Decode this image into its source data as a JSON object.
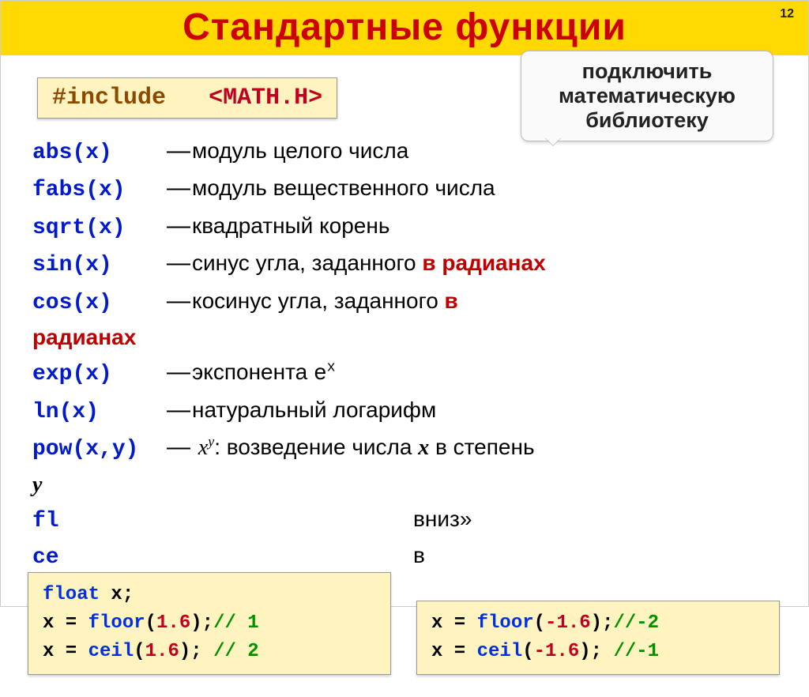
{
  "slide_number": "12",
  "title": "Стандартные функции",
  "callout": "подключить математическую библиотеку",
  "include": {
    "directive": "#include",
    "header": "<MATH.H>"
  },
  "funcs": [
    {
      "name": "abs(x)",
      "desc_before": "модуль целого числа",
      "desc_red": "",
      "desc_after": ""
    },
    {
      "name": "fabs(x)",
      "desc_before": "модуль вещественного числа",
      "desc_red": "",
      "desc_after": ""
    },
    {
      "name": "sqrt(x)",
      "desc_before": "квадратный корень",
      "desc_red": "",
      "desc_after": ""
    },
    {
      "name": "sin(x)",
      "desc_before": "синус угла, заданного ",
      "desc_red": "в радианах",
      "desc_after": ""
    },
    {
      "name": "cos(x)",
      "desc_before": "косинус угла, заданного ",
      "desc_red": "в",
      "desc_after": ""
    }
  ],
  "radians_wrap": "радианах",
  "funcs2": [
    {
      "name": "exp(x)",
      "desc_before": "экспонента ",
      "extra_mono": "e",
      "sup": "x",
      "desc_after": ""
    },
    {
      "name": "ln(x)",
      "desc_before": "натуральный логарифм",
      "extra_mono": "",
      "sup": "",
      "desc_after": ""
    },
    {
      "name": "pow(x,y)",
      "desc_before": "",
      "formula_base": "x",
      "formula_sup": "y",
      "desc_after": ": возведение числа ",
      "ital": "x",
      "desc_tail": " в степень"
    }
  ],
  "y_tail": "y",
  "behind": {
    "fl": "fl",
    "down_tail": "вниз»",
    "ce": "ce",
    "up_tail": "в"
  },
  "codebox_left": {
    "l1_a": "float ",
    "l1_b": "x;",
    "l2_a": "x",
    "l2_eq": " = ",
    "l2_fn": "floor",
    "l2_open": "(",
    "l2_num": "1.6",
    "l2_close": ");",
    "l2_cmt": "// 1",
    "l3_a": "x",
    "l3_eq": " = ",
    "l3_fn": "ceil",
    "l3_open": "(",
    "l3_num": "1.6",
    "l3_close": "); ",
    "l3_cmt": "// 2"
  },
  "codebox_right": {
    "l1_a": "x",
    "l1_eq": " = ",
    "l1_fn": "floor",
    "l1_open": "(",
    "l1_num": "-1.6",
    "l1_close": ");",
    "l1_cmt": "//-2",
    "l2_a": "x",
    "l2_eq": " = ",
    "l2_fn": "ceil",
    "l2_open": "(",
    "l2_num": "-1.6",
    "l2_close": "); ",
    "l2_cmt": "//-1"
  }
}
